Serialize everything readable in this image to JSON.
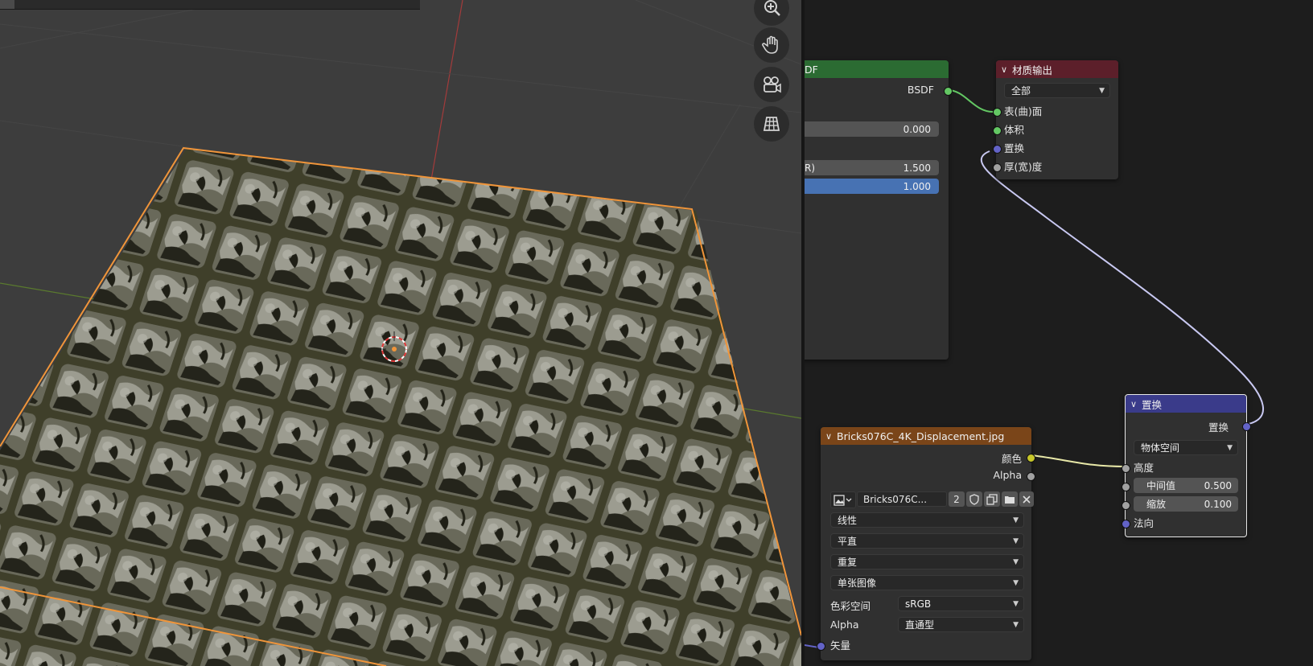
{
  "viewport": {
    "nav": [
      "zoom-icon",
      "hand-pan-icon",
      "camera-view-icon",
      "grid-ortho-icon"
    ]
  },
  "bsdf_node": {
    "header_fragment": "DF",
    "output_label": "BSDF",
    "value1": "0.000",
    "value2_label": "R)",
    "value2": "1.500",
    "value3": "1.000"
  },
  "material_output": {
    "title": "材质输出",
    "target": "全部",
    "inputs": [
      "表(曲)面",
      "体积",
      "置换",
      "厚(宽)度"
    ]
  },
  "displacement_node": {
    "title": "置换",
    "output_label": "置换",
    "space": "物体空间",
    "height_label": "高度",
    "midlevel_label": "中间值",
    "midlevel_value": "0.500",
    "scale_label": "缩放",
    "scale_value": "0.100",
    "normal_label": "法向"
  },
  "image_node": {
    "title": "Bricks076C_4K_Displacement.jpg",
    "out_color": "颜色",
    "out_alpha": "Alpha",
    "image_name": "Bricks076C...",
    "users": "2",
    "interpolation": "线性",
    "projection": "平直",
    "extension": "重复",
    "source": "单张图像",
    "colorspace_label": "色彩空间",
    "colorspace": "sRGB",
    "alpha_label": "Alpha",
    "alpha_mode": "直通型",
    "vector_label": "矢量"
  },
  "colors": {
    "header_green": "#2b6b32",
    "header_red": "#5c1f2a",
    "header_blue": "#3a3b8a",
    "header_orange": "#7a4519",
    "socket_green": "#63c763",
    "socket_purple": "#6363c7",
    "socket_gray": "#a1a1a1",
    "socket_yellow": "#c7c729",
    "field_blue": "#4772b3"
  }
}
